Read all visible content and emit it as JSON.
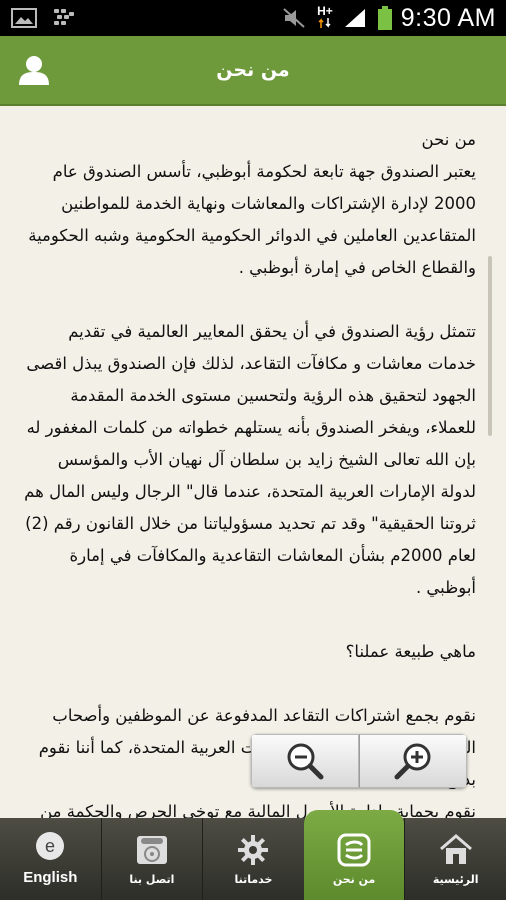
{
  "status_bar": {
    "time": "9:30 AM",
    "network": "H+",
    "icons": [
      "image-icon",
      "bbm-icon",
      "mute-icon",
      "network-icon",
      "signal-icon",
      "battery-icon"
    ]
  },
  "header": {
    "title": "من نحن",
    "user_icon": "user-icon"
  },
  "content": {
    "paragraphs": [
      "من نحن\nيعتبر الصندوق جهة تابعة لحكومة أبوظبي، تأسس الصندوق عام 2000 لإدارة الإشتراكات والمعاشات ونهاية الخدمة للمواطنين المتقاعدين العاملين في الدوائر الحكومية الحكومية وشبه الحكومية والقطاع الخاص في إمارة أبوظبي .",
      "تتمثل رؤية الصندوق في أن يحقق المعايير العالمية في تقديم خدمات معاشات و مكافآت التقاعد، لذلك فإن الصندوق يبذل اقصى الجهود لتحقيق هذه الرؤية ولتحسين مستوى الخدمة المقدمة للعملاء، ويفخر الصندوق بأنه يستلهم خطواته من كلمات المغفور له بإن الله تعالى الشيخ زايد بن سلطان آل نهيان الأب والمؤسس لدولة الإمارات العربية المتحدة، عندما قال\" الرجال وليس المال هم ثروتنا الحقيقية\" وقد تم تحديد مسؤولياتنا من خلال القانون رقم (2) لعام 2000م بشأن المعاشات التقاعدية والمكافآت في إمارة أبوظبي .",
      "ماهي طبيعة عملنا؟",
      "نقوم بجمع اشتراكات التقاعد المدفوعة عن الموظفين وأصحاب العمل المواطنين في دولة الإمارات العربية المتحدة، كما أننا نقوم بدفع المعاشات التقاعدية\nنقوم بحماية وإدارة الأصول المالية مع توخي الحرص والحكمة من"
    ]
  },
  "zoom": {
    "zoom_out_icon": "zoom-out-icon",
    "zoom_in_icon": "zoom-in-icon"
  },
  "tabs": [
    {
      "label": "English",
      "icon": "english-icon",
      "active": false
    },
    {
      "label": "اتصل بنا",
      "icon": "phone-icon",
      "active": false
    },
    {
      "label": "خدماتنا",
      "icon": "gear-icon",
      "active": false
    },
    {
      "label": "من نحن",
      "icon": "about-logo-icon",
      "active": true
    },
    {
      "label": "الرئيسية",
      "icon": "home-icon",
      "active": false
    }
  ],
  "colors": {
    "header_green": "#6f9a3c",
    "active_tab_green": "#6f9e37",
    "background": "#f3f1e7",
    "tabbar_dark": "#3b3b34"
  }
}
